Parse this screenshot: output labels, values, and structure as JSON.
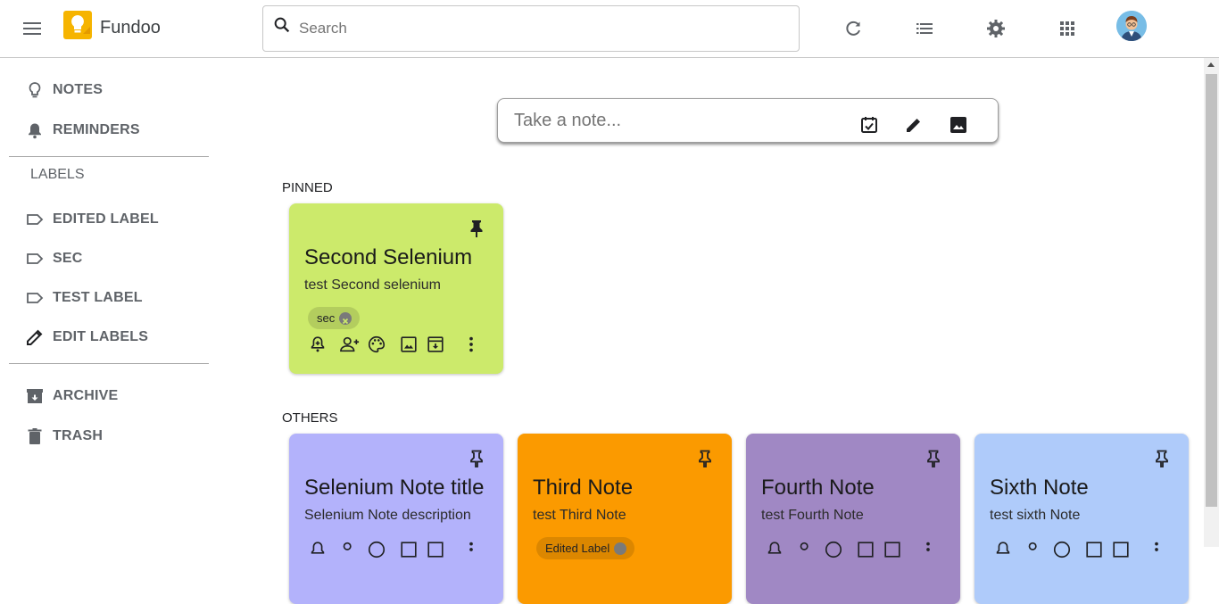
{
  "header": {
    "app_title": "Fundoo",
    "search_placeholder": "Search",
    "icons": [
      "menu-icon",
      "bulb-logo-icon",
      "search-icon",
      "refresh-icon",
      "list-view-icon",
      "settings-icon",
      "apps-grid-icon",
      "avatar"
    ]
  },
  "sidebar": {
    "items_top": [
      {
        "label": "NOTES",
        "icon": "bulb-icon"
      },
      {
        "label": "REMINDERS",
        "icon": "bell-icon"
      }
    ],
    "labels_heading": "LABELS",
    "labels": [
      {
        "label": "EDITED LABEL",
        "icon": "label-icon"
      },
      {
        "label": "SEC",
        "icon": "label-icon"
      },
      {
        "label": "TEST LABEL",
        "icon": "label-icon"
      },
      {
        "label": "EDIT LABELS",
        "icon": "pencil-icon"
      }
    ],
    "items_bottom": [
      {
        "label": "ARCHIVE",
        "icon": "archive-icon"
      },
      {
        "label": "TRASH",
        "icon": "trash-icon"
      }
    ]
  },
  "take_note": {
    "placeholder": "Take a note...",
    "icons": [
      "checklist-icon",
      "pencil-icon",
      "image-icon"
    ]
  },
  "pinned": {
    "heading": "PINNED",
    "notes": [
      {
        "title": "Second Selenium",
        "description": "test Second selenium",
        "label_chip": "sec",
        "color": "#ccea6b"
      }
    ]
  },
  "others": {
    "heading": "OTHERS",
    "notes": [
      {
        "title": "Selenium Note title",
        "description": "Selenium Note description",
        "color": "#b3b2fb"
      },
      {
        "title": "Third Note",
        "description": "test Third Note",
        "label_chip": "Edited Label",
        "color": "#fb9a00"
      },
      {
        "title": "Fourth Note",
        "description": "test Fourth Note",
        "color": "#a088c4"
      },
      {
        "title": "Sixth Note",
        "description": "test sixth Note",
        "color": "#afcbfa"
      }
    ]
  },
  "card_action_icons": [
    "remind-me-icon",
    "collaborator-icon",
    "palette-icon",
    "image-icon",
    "archive-icon",
    "more-vert-icon"
  ]
}
